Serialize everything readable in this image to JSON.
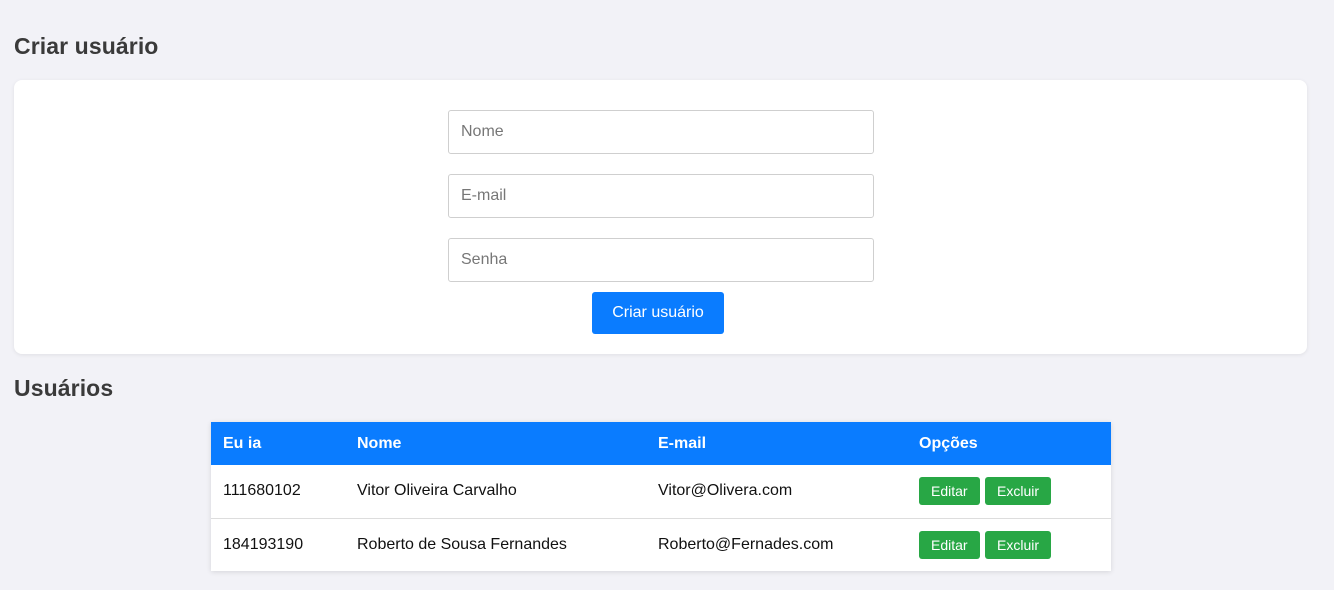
{
  "create_section": {
    "title": "Criar usuário",
    "fields": {
      "nome": {
        "placeholder": "Nome",
        "value": ""
      },
      "email": {
        "placeholder": "E-mail",
        "value": ""
      },
      "senha": {
        "placeholder": "Senha",
        "value": ""
      }
    },
    "submit_label": "Criar usuário"
  },
  "users_section": {
    "title": "Usuários",
    "columns": [
      "Eu ia",
      "Nome",
      "E-mail",
      "Opções"
    ],
    "rows": [
      {
        "id": "111680102",
        "nome": "Vitor Oliveira Carvalho",
        "email": "Vitor@Olivera.com",
        "edit_label": "Editar",
        "delete_label": "Excluir"
      },
      {
        "id": "184193190",
        "nome": "Roberto de Sousa Fernandes",
        "email": "Roberto@Fernades.com",
        "edit_label": "Editar",
        "delete_label": "Excluir"
      }
    ]
  },
  "colors": {
    "primary": "#0a7cff",
    "success": "#28a745",
    "background": "#f2f2f7",
    "card": "#ffffff"
  }
}
